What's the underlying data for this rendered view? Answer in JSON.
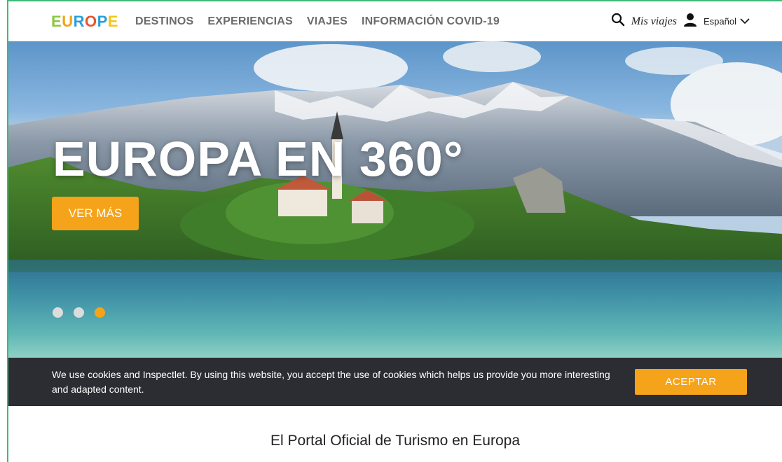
{
  "header": {
    "logo_letters": [
      {
        "char": "E",
        "color": "#8cc63f"
      },
      {
        "char": "U",
        "color": "#f5a31a"
      },
      {
        "char": "R",
        "color": "#2a9fd8"
      },
      {
        "char": "O",
        "color": "#e4572e"
      },
      {
        "char": "P",
        "color": "#2a9fd8"
      },
      {
        "char": "E",
        "color": "#f5c518"
      }
    ],
    "nav": [
      "DESTINOS",
      "EXPERIENCIAS",
      "VIAJES",
      "INFORMACIÓN COVID-19"
    ],
    "search_icon": "search-icon",
    "mis_viajes": "Mis viajes",
    "user_icon": "user-icon",
    "language": "Español",
    "chevron_icon": "chevron-down-icon"
  },
  "hero": {
    "title": "EUROPA EN 360°",
    "button": "VER MÁS",
    "carousel": {
      "count": 3,
      "active": 3
    }
  },
  "cookie": {
    "text": "We use cookies and Inspectlet. By using this website, you accept the use of cookies which helps us provide you more interesting and adapted content.",
    "accept": "ACEPTAR"
  },
  "main": {
    "title": "El Portal Oficial de Turismo en Europa"
  },
  "colors": {
    "accent": "#f5a31a",
    "nav_text": "#6b6b6b",
    "cookie_bg": "#2b2d33",
    "frame": "#3fb97a"
  }
}
